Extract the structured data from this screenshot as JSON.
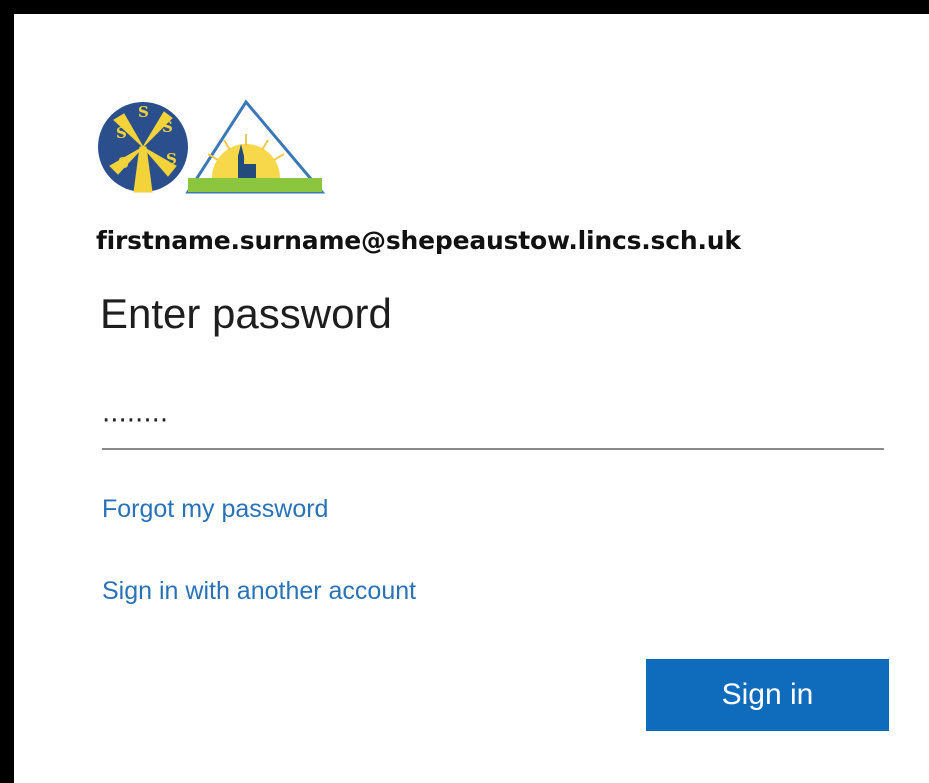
{
  "account": {
    "email": "firstname.surname@shepeaustow.lincs.sch.uk"
  },
  "page": {
    "title": "Enter password"
  },
  "password_field": {
    "value": "········",
    "masked": true
  },
  "links": {
    "forgot_password": "Forgot my password",
    "other_account": "Sign in with another account"
  },
  "actions": {
    "sign_in": "Sign in"
  },
  "colors": {
    "accent": "#0f6cbd",
    "link": "#2a72b8",
    "logo_circle": "#2b4f8c",
    "logo_yellow": "#f2d33a",
    "logo_green": "#8cc63f"
  },
  "icons": {
    "logo": "school-logo-windmill-sun-icon"
  }
}
